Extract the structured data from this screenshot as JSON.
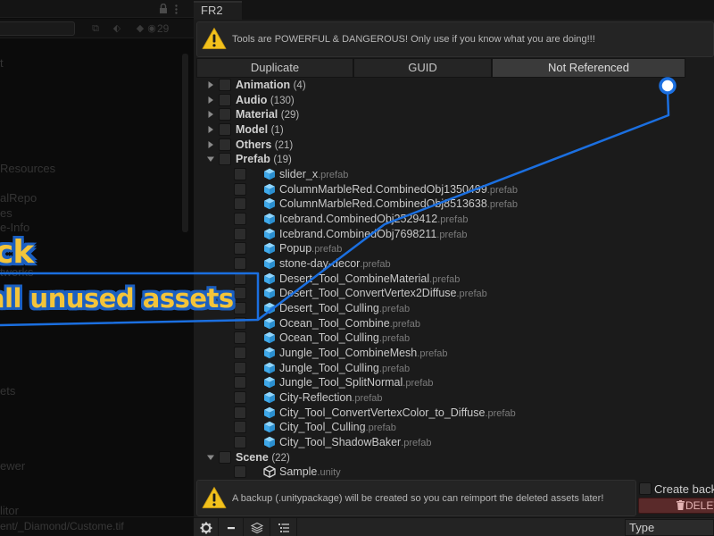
{
  "left_panel": {
    "count": "29",
    "texts": [
      "t",
      "Resources",
      "alRepo",
      "es",
      "e-Info",
      "tworks",
      "ets",
      "ewer",
      "litor"
    ],
    "status_path": "ent/_Diamond/Custome.tif"
  },
  "window": {
    "tab_title": "FR2"
  },
  "top_warning": "Tools are POWERFUL & DANGEROUS! Only use if you know what you are doing!!!",
  "mode_tabs": [
    "Duplicate",
    "GUID",
    "Not Referenced"
  ],
  "active_mode": "Not Referenced",
  "categories": [
    {
      "name": "Animation",
      "count": "(4)",
      "expanded": false
    },
    {
      "name": "Audio",
      "count": "(130)",
      "expanded": false
    },
    {
      "name": "Material",
      "count": "(29)",
      "expanded": false
    },
    {
      "name": "Model",
      "count": "(1)",
      "expanded": false
    },
    {
      "name": "Others",
      "count": "(21)",
      "expanded": false
    },
    {
      "name": "Prefab",
      "count": "(19)",
      "expanded": true,
      "items": [
        {
          "name": "slider_x",
          "ext": ".prefab"
        },
        {
          "name": "ColumnMarbleRed.CombinedObj1350499",
          "ext": ".prefab"
        },
        {
          "name": "ColumnMarbleRed.CombinedObj8513638",
          "ext": ".prefab"
        },
        {
          "name": "Icebrand.CombinedObj2529412",
          "ext": ".prefab"
        },
        {
          "name": "Icebrand.CombinedObj7698211",
          "ext": ".prefab"
        },
        {
          "name": "Popup",
          "ext": ".prefab"
        },
        {
          "name": "stone-day-decor",
          "ext": ".prefab"
        },
        {
          "name": "Desert_Tool_CombineMaterial",
          "ext": ".prefab"
        },
        {
          "name": "Desert_Tool_ConvertVertex2Diffuse",
          "ext": ".prefab"
        },
        {
          "name": "Desert_Tool_Culling",
          "ext": ".prefab"
        },
        {
          "name": "Ocean_Tool_Combine",
          "ext": ".prefab"
        },
        {
          "name": "Ocean_Tool_Culling",
          "ext": ".prefab"
        },
        {
          "name": "Jungle_Tool_CombineMesh",
          "ext": ".prefab"
        },
        {
          "name": "Jungle_Tool_Culling",
          "ext": ".prefab"
        },
        {
          "name": "Jungle_Tool_SplitNormal",
          "ext": ".prefab"
        },
        {
          "name": "City-Reflection",
          "ext": ".prefab"
        },
        {
          "name": "City_Tool_ConvertVertexColor_to_Diffuse",
          "ext": ".prefab"
        },
        {
          "name": "City_Tool_Culling",
          "ext": ".prefab"
        },
        {
          "name": "City_Tool_ShadowBaker",
          "ext": ".prefab"
        }
      ]
    },
    {
      "name": "Scene",
      "count": "(22)",
      "expanded": true,
      "items": [
        {
          "name": "Sample",
          "ext": ".unity"
        }
      ]
    }
  ],
  "bottom_warning": "A backup (.unitypackage) will be created so you can reimport the deleted assets later!",
  "backup_label": "Create backup",
  "delete_label": "DELETE",
  "type_dropdown": "Type",
  "callout": {
    "word": "ck",
    "line": "all unused assets"
  },
  "colors": {
    "accent_blue": "#1b6fe0",
    "callout_yellow": "#f3c43a",
    "prefab_icon": "#4fb6f0",
    "warning_yellow": "#f2c11c",
    "delete_red": "#5a2a2a"
  },
  "icons": {
    "warning": "warning-triangle-icon",
    "prefab": "prefab-cube-icon",
    "scene": "unity-scene-icon",
    "settings": "gear-icon",
    "remove": "minus-icon",
    "layers": "layers-icon",
    "list": "list-icon",
    "trash": "trash-icon"
  }
}
